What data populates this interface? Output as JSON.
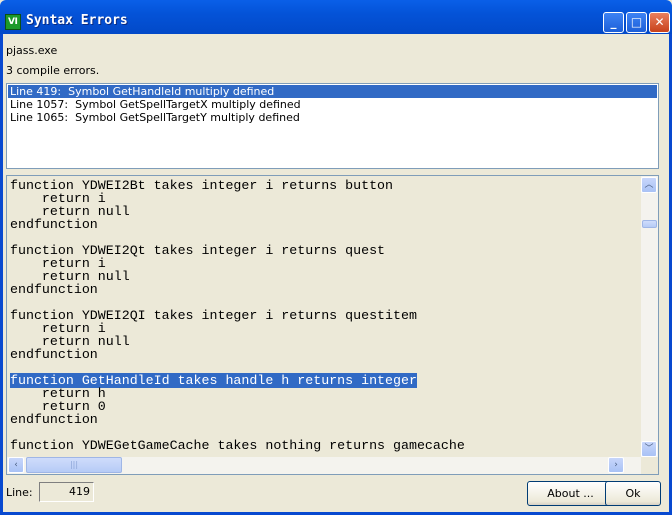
{
  "window": {
    "title": "Syntax Errors",
    "icon": "app-logo-icon",
    "minimize": "_",
    "maximize": "□",
    "close": "✕"
  },
  "header": {
    "program": "pjass.exe",
    "summary": "3 compile errors."
  },
  "errors": [
    {
      "text": "Line 419:  Symbol GetHandleId multiply defined",
      "selected": true
    },
    {
      "text": "Line 1057:  Symbol GetSpellTargetX multiply defined",
      "selected": false
    },
    {
      "text": "Line 1065:  Symbol GetSpellTargetY multiply defined",
      "selected": false
    }
  ],
  "code": {
    "lines": [
      "function YDWEI2Bt takes integer i returns button",
      "    return i",
      "    return null",
      "endfunction",
      "",
      "function YDWEI2Qt takes integer i returns quest",
      "    return i",
      "    return null",
      "endfunction",
      "",
      "function YDWEI2QI takes integer i returns questitem",
      "    return i",
      "    return null",
      "endfunction",
      "",
      "function GetHandleId takes handle h returns integer",
      "    return h",
      "    return 0",
      "endfunction",
      "",
      "function YDWEGetGameCache takes nothing returns gamecache"
    ],
    "highlighted_line": "function GetHandleId takes handle h returns integer"
  },
  "footer": {
    "line_label": "Line:",
    "line_value": "419",
    "about_label": "About ...",
    "ok_label": "Ok"
  },
  "colors": {
    "titlebar": "#0453d8",
    "selection": "#316ac5"
  }
}
